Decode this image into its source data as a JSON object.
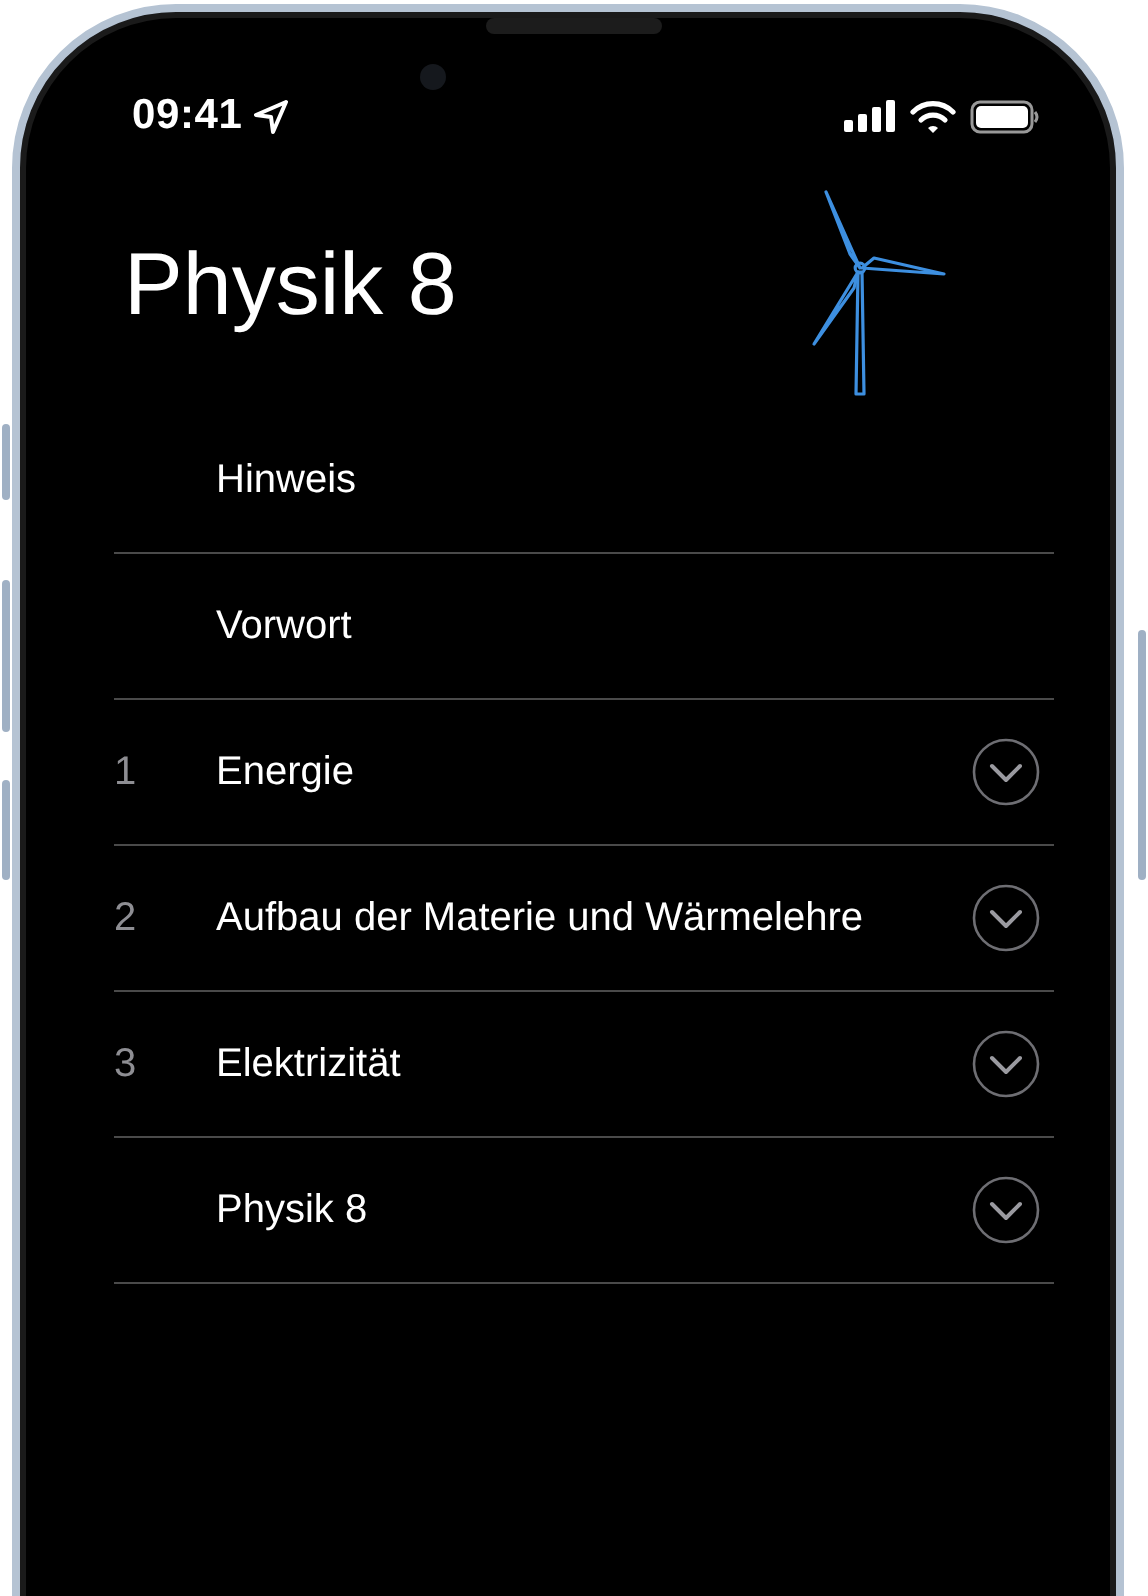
{
  "status_bar": {
    "time": "09:41"
  },
  "title": "Physik 8",
  "items": [
    {
      "kind": "page",
      "label": "Hinweis"
    },
    {
      "kind": "page",
      "label": "Vorwort"
    },
    {
      "kind": "section",
      "number": "1",
      "label": "Energie",
      "expanded": false
    },
    {
      "kind": "section",
      "number": "2",
      "label": "Aufbau der Materie und Wärmelehre",
      "expanded": false
    },
    {
      "kind": "section",
      "number": "3",
      "label": "Elektrizität",
      "expanded": false
    },
    {
      "kind": "section",
      "label": "Physik 8",
      "expanded": false
    }
  ]
}
